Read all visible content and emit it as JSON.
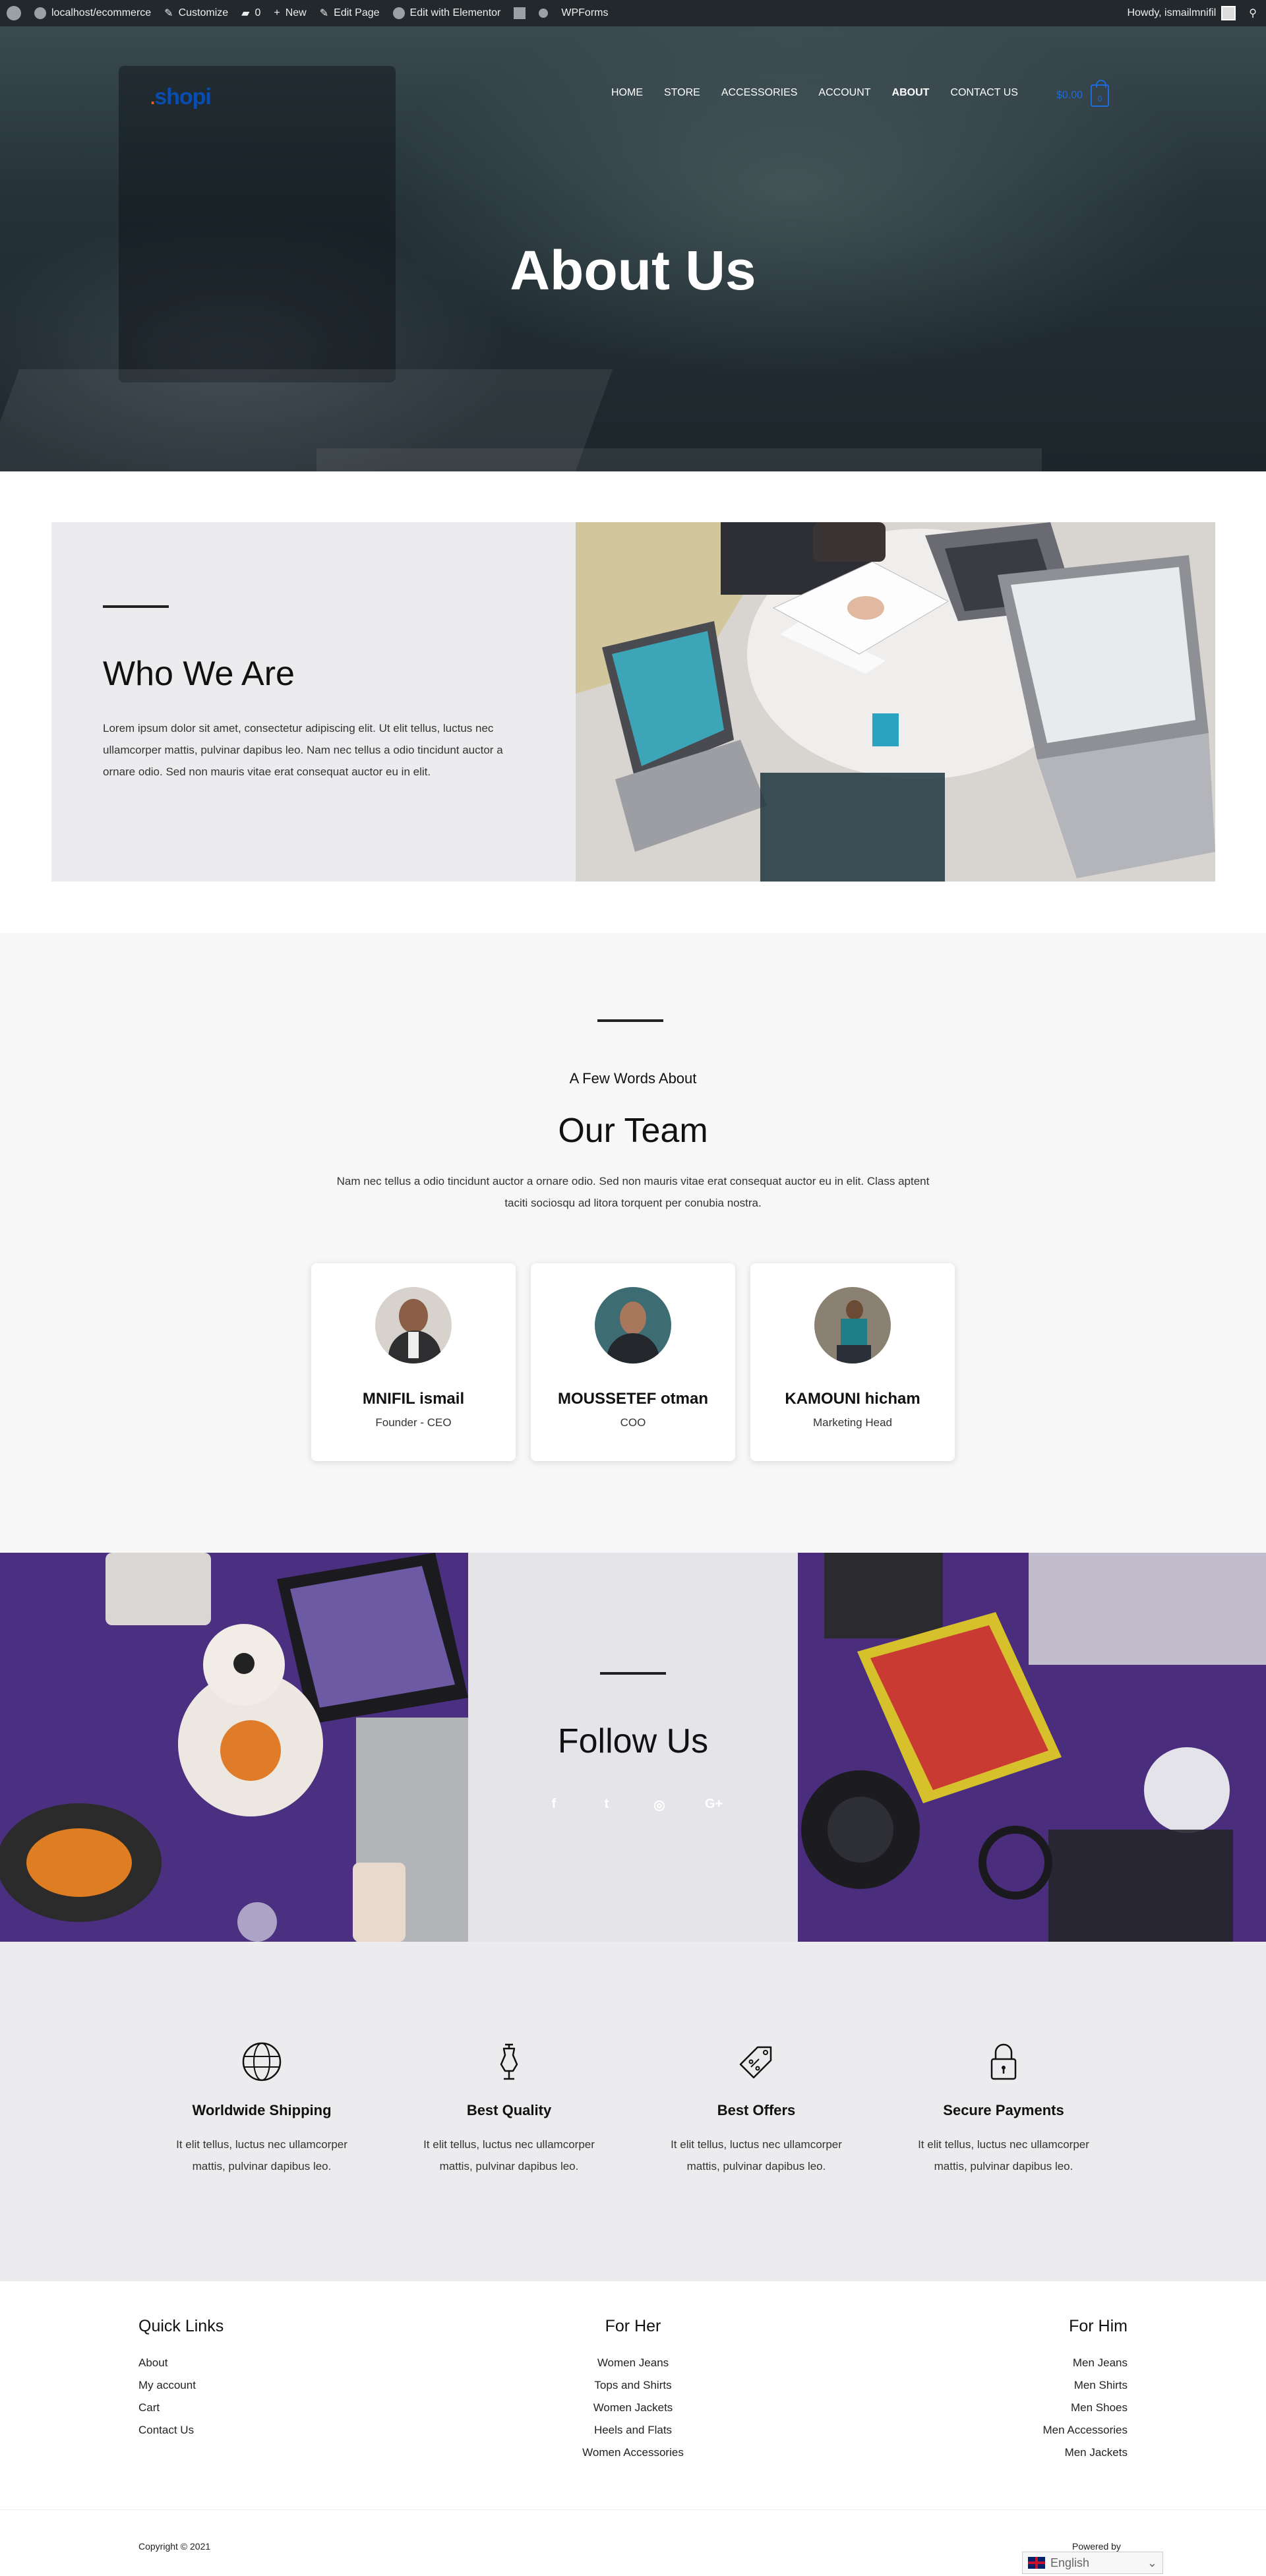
{
  "admin_bar": {
    "site": "localhost/ecommerce",
    "customize": "Customize",
    "comments_count": "0",
    "new": "New",
    "edit_page": "Edit Page",
    "edit_elementor": "Edit with Elementor",
    "wpforms": "WPForms",
    "howdy": "Howdy, ismailmnifil"
  },
  "header": {
    "logo_dot": ".",
    "logo_text": "shopi",
    "menu": [
      "HOME",
      "STORE",
      "ACCESSORIES",
      "ACCOUNT",
      "ABOUT",
      "CONTACT US"
    ],
    "active_menu": "ABOUT",
    "cart_amount": "$0.00",
    "cart_count": "0"
  },
  "hero": {
    "title": "About Us"
  },
  "who": {
    "title": "Who We Are",
    "text": "Lorem ipsum dolor sit amet, consectetur adipiscing elit. Ut elit tellus, luctus nec ullamcorper mattis, pulvinar dapibus leo. Nam nec tellus a odio tincidunt auctor a ornare odio. Sed non mauris vitae erat consequat auctor eu in elit."
  },
  "team": {
    "kicker": "A Few Words About",
    "title": "Our Team",
    "desc": "Nam nec tellus a odio tincidunt auctor a ornare odio. Sed non mauris vitae erat consequat auctor eu in elit. Class aptent taciti sociosqu ad litora torquent per conubia nostra.",
    "members": [
      {
        "name": "MNIFIL ismail",
        "role": "Founder - CEO"
      },
      {
        "name": "MOUSSETEF otman",
        "role": "COO"
      },
      {
        "name": "KAMOUNI hicham",
        "role": "Marketing Head"
      }
    ]
  },
  "follow": {
    "title": "Follow Us",
    "icons": [
      "facebook-icon",
      "twitter-icon",
      "instagram-icon",
      "google-plus-icon"
    ],
    "glyphs": [
      "f",
      "t",
      "◎",
      "G+"
    ]
  },
  "features": [
    {
      "title": "Worldwide Shipping",
      "text": "It elit tellus, luctus nec ullamcorper mattis, pulvinar dapibus leo.",
      "icon": "globe-icon"
    },
    {
      "title": "Best Quality",
      "text": "It elit tellus, luctus nec ullamcorper mattis, pulvinar dapibus leo.",
      "icon": "dress-form-icon"
    },
    {
      "title": "Best Offers",
      "text": "It elit tellus, luctus nec ullamcorper mattis, pulvinar dapibus leo.",
      "icon": "price-tag-icon"
    },
    {
      "title": "Secure Payments",
      "text": "It elit tellus, luctus nec ullamcorper mattis, pulvinar dapibus leo.",
      "icon": "lock-icon"
    }
  ],
  "footer": {
    "quick_links": {
      "title": "Quick Links",
      "items": [
        "About",
        "My account",
        "Cart",
        "Contact Us"
      ]
    },
    "for_her": {
      "title": "For Her",
      "items": [
        "Women Jeans",
        "Tops and Shirts",
        "Women Jackets",
        "Heels and Flats",
        "Women Accessories"
      ]
    },
    "for_him": {
      "title": "For Him",
      "items": [
        "Men Jeans",
        "Men Shirts",
        "Men Shoes",
        "Men Accessories",
        "Men Jackets"
      ]
    },
    "copyright": "Copyright © 2021",
    "powered_by": "Powered by",
    "language": "English"
  },
  "colors": {
    "accent": "#1d6ad8",
    "logo_dot": "#e8612c",
    "purple": "#4b2f80"
  }
}
